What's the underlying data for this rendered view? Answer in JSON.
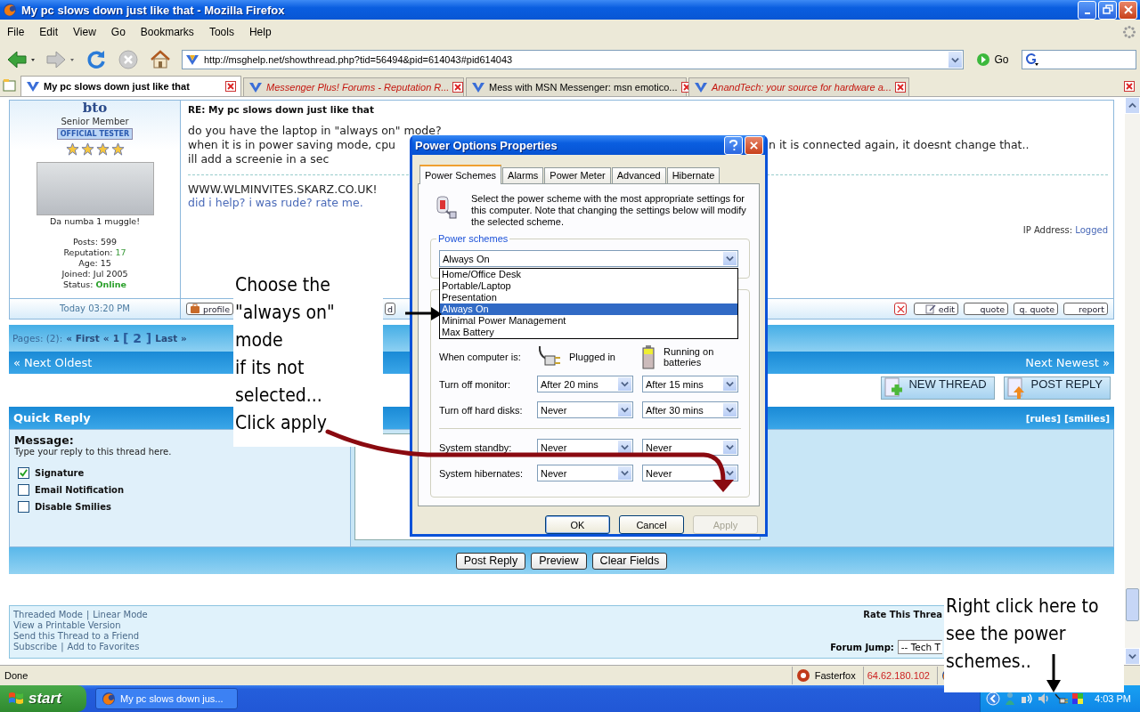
{
  "window": {
    "title": "My pc slows down just like that - Mozilla Firefox"
  },
  "menu": [
    "File",
    "Edit",
    "View",
    "Go",
    "Bookmarks",
    "Tools",
    "Help"
  ],
  "address": {
    "value": "http://msghelp.net/showthread.php?tid=56494&pid=614043#pid614043",
    "go": "Go"
  },
  "tabs": [
    {
      "label": "My pc slows down just like that",
      "selected": true,
      "unread": false
    },
    {
      "label": "Messenger Plus! Forums - Reputation R...",
      "selected": false,
      "unread": true
    },
    {
      "label": "Mess with MSN Messenger: msn emotico...",
      "selected": false,
      "unread": false
    },
    {
      "label": "AnandTech: your source for hardware a...",
      "selected": false,
      "unread": true
    }
  ],
  "post": {
    "author": "bto",
    "rank": "Senior Member",
    "badge": "OFFICIAL TESTER",
    "stars": 4,
    "avatar_caption": "Da numba 1 muggle!",
    "stats": [
      {
        "label": "Posts:",
        "value": "599",
        "kind": "plain"
      },
      {
        "label": "Reputation:",
        "value": "17",
        "kind": "reputation"
      },
      {
        "label": "Age:",
        "value": "15",
        "kind": "plain"
      },
      {
        "label": "Joined:",
        "value": "Jul 2005",
        "kind": "plain"
      },
      {
        "label": "Status:",
        "value": "Online",
        "kind": "status"
      }
    ],
    "title": "RE: My pc slows down just like that",
    "line_1": "do you have the laptop in \"always on\" mode?",
    "line_2_left": "when it is in power saving mode, cpu",
    "line_2_right": "n it is connected again, it doesnt change that..",
    "line_3": "ill add a screenie in a sec",
    "signature": "WWW.WLMINVITES.SKARZ.CO.UK!",
    "signature_link": "did i help? i was rude? rate me.",
    "ip_label": "IP Address:",
    "ip_value": "Logged",
    "date": "Today 03:20 PM",
    "left_buttons": [
      "profile",
      "d"
    ],
    "right_buttons": [
      "edit",
      "quote",
      "q. quote",
      "report"
    ]
  },
  "pages": {
    "label": "Pages: (2):",
    "items": [
      {
        "text": "« First",
        "kind": "link"
      },
      {
        "text": "«",
        "kind": "link"
      },
      {
        "text": "1",
        "kind": "link"
      },
      {
        "text": "[ 2 ]",
        "kind": "current"
      },
      {
        "text": "Last »",
        "kind": "link"
      }
    ]
  },
  "nav": {
    "older": "« Next Oldest",
    "newer": "Next Newest »"
  },
  "thread_buttons": [
    "NEW THREAD",
    "POST REPLY"
  ],
  "quick_reply": {
    "title": "Quick Reply",
    "links": [
      "[rules]",
      "[smilies]"
    ],
    "message_label": "Message:",
    "hint": "Type your reply to this thread here.",
    "options": [
      {
        "label": "Signature",
        "checked": true
      },
      {
        "label": "Email Notification",
        "checked": false
      },
      {
        "label": "Disable Smilies",
        "checked": false
      }
    ],
    "buttons": [
      "Post Reply",
      "Preview",
      "Clear Fields"
    ]
  },
  "footer": {
    "links": [
      [
        "Threaded Mode",
        "Linear Mode"
      ],
      [
        "View a Printable Version"
      ],
      [
        "Send this Thread to a Friend"
      ],
      [
        "Subscribe",
        "Add to Favorites"
      ]
    ],
    "separator": "|",
    "rate_label": "Rate This Threa",
    "jump_label": "Forum Jump:",
    "jump_value": "-- Tech T"
  },
  "status_bar": {
    "text": "Done",
    "extension": "Fasterfox",
    "ip": "64.62.180.102"
  },
  "taskbar": {
    "start": "start",
    "task": "My pc slows down jus...",
    "time": "4:03 PM"
  },
  "dialog": {
    "title": "Power Options Properties",
    "tabs": [
      {
        "label": "Power Schemes",
        "selected": true
      },
      {
        "label": "Alarms",
        "selected": false
      },
      {
        "label": "Power Meter",
        "selected": false
      },
      {
        "label": "Advanced",
        "selected": false
      },
      {
        "label": "Hibernate",
        "selected": false
      }
    ],
    "description": "Select the power scheme with the most appropriate settings for this computer. Note that changing the settings below will modify the selected scheme.",
    "group_label": "Power schemes",
    "scheme": "Always On",
    "options": [
      {
        "label": "Home/Office Desk",
        "selected": false
      },
      {
        "label": "Portable/Laptop",
        "selected": false
      },
      {
        "label": "Presentation",
        "selected": false
      },
      {
        "label": "Always On",
        "selected": true
      },
      {
        "label": "Minimal Power Management",
        "selected": false
      },
      {
        "label": "Max Battery",
        "selected": false
      }
    ],
    "when_label": "When computer is:",
    "plugged_label": "Plugged in",
    "battery_label": "Running on batteries",
    "settings": [
      {
        "label": "Turn off monitor:",
        "plugged": "After 20 mins",
        "battery": "After 15 mins"
      },
      {
        "label": "Turn off hard disks:",
        "plugged": "Never",
        "battery": "After 30 mins"
      },
      {
        "label": "System standby:",
        "plugged": "Never",
        "battery": "Never"
      },
      {
        "label": "System hibernates:",
        "plugged": "Never",
        "battery": "Never"
      }
    ],
    "buttons": [
      {
        "label": "OK",
        "disabled": false
      },
      {
        "label": "Cancel",
        "disabled": false
      },
      {
        "label": "Apply",
        "disabled": true
      }
    ]
  },
  "notes": [
    {
      "text": "Choose the\n\"always on\"\nmode\nif its not\nselected...\nClick apply"
    },
    {
      "text": "Right click here to see the power schemes.."
    }
  ]
}
